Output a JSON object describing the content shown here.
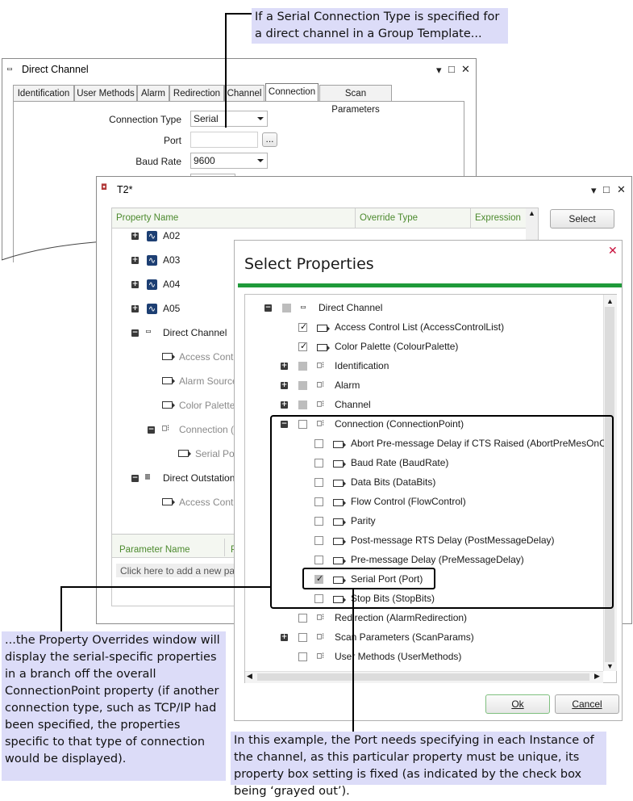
{
  "callouts": {
    "top": "If a Serial Connection Type is specified for a direct channel in a Group Template...",
    "left": "...the Property Overrides window will display the serial-specific properties in a branch off the overall ConnectionPoint property (if another connection type, such as TCP/IP had been specified, the properties specific to that type of connection would be displayed).",
    "bottom": "In this example, the Port needs specifying in each Instance of the channel, as this particular property must be unique, its property box setting is fixed (as indicated by the check box being ‘grayed out’)."
  },
  "direct_channel": {
    "title": "Direct Channel",
    "tabs": [
      "Identification",
      "User Methods",
      "Alarm",
      "Redirection",
      "Channel",
      "Connection",
      "Scan Parameters"
    ],
    "active_tab": "Connection",
    "connection_type_label": "Connection Type",
    "connection_type_value": "Serial",
    "port_label": "Port",
    "port_value": "",
    "browse_label": "...",
    "baud_rate_label": "Baud Rate",
    "baud_rate_value": "9600"
  },
  "t2": {
    "title": "T2*",
    "columns": [
      "Property Name",
      "Override Type",
      "Expression"
    ],
    "select_button": "Select",
    "rows": [
      "A02",
      "A03",
      "A04",
      "A05",
      "Direct Channel",
      "Access Contro",
      "Alarm Source",
      "Color Palette",
      "Connection (",
      "Serial Por",
      "Direct Outstation",
      "Access Contro"
    ],
    "param_header": "Parameter Name",
    "param_header2": "P",
    "param_placeholder": "Click here to add a new pa"
  },
  "select_properties": {
    "title": "Select Properties",
    "close_glyph": "✕",
    "ok_label": "Ok",
    "cancel_label": "Cancel",
    "items": [
      "Direct Channel",
      "Access Control List (AccessControlList)",
      "Color Palette (ColourPalette)",
      "Identification",
      "Alarm",
      "Channel",
      "Connection (ConnectionPoint)",
      "Abort Pre-message Delay if CTS Raised (AbortPreMesOnCTS",
      "Baud Rate (BaudRate)",
      "Data Bits (DataBits)",
      "Flow Control (FlowControl)",
      "Parity",
      "Post-message RTS Delay (PostMessageDelay)",
      "Pre-message Delay (PreMessageDelay)",
      "Serial Port (Port)",
      "Stop Bits (StopBits)",
      "Redirection (AlarmRedirection)",
      "Scan Parameters (ScanParams)",
      "User Methods (UserMethods)"
    ]
  },
  "window_controls": {
    "dropdown": "▾",
    "maximize": "□",
    "close": "✕"
  },
  "colors": {
    "callout_bg": "#dcdcf8",
    "accent_green": "#1f9a3a",
    "close_red": "#c8103c"
  }
}
